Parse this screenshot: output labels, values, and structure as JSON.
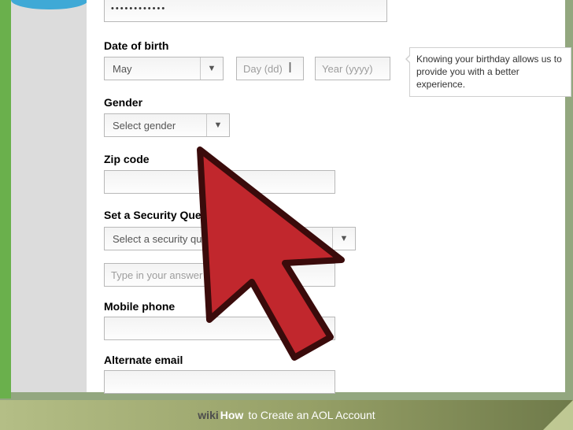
{
  "password_field": {
    "value": "••••••••••••"
  },
  "dob": {
    "label": "Date of birth",
    "month_selected": "May",
    "day_placeholder": "Day (dd)",
    "year_placeholder": "Year (yyyy)"
  },
  "tooltip": {
    "text": "Knowing your birthday allows us to provide you with a better experience."
  },
  "gender": {
    "label": "Gender",
    "selected": "Select gender"
  },
  "zip": {
    "label": "Zip code"
  },
  "security": {
    "label": "Set a Security Question",
    "selected": "Select a security question",
    "answer_placeholder": "Type in your answer"
  },
  "mobile": {
    "label": "Mobile phone"
  },
  "alt_email": {
    "label": "Alternate email"
  },
  "footer": {
    "wiki": "wiki",
    "how": "How",
    "title": " to Create an AOL Account"
  }
}
